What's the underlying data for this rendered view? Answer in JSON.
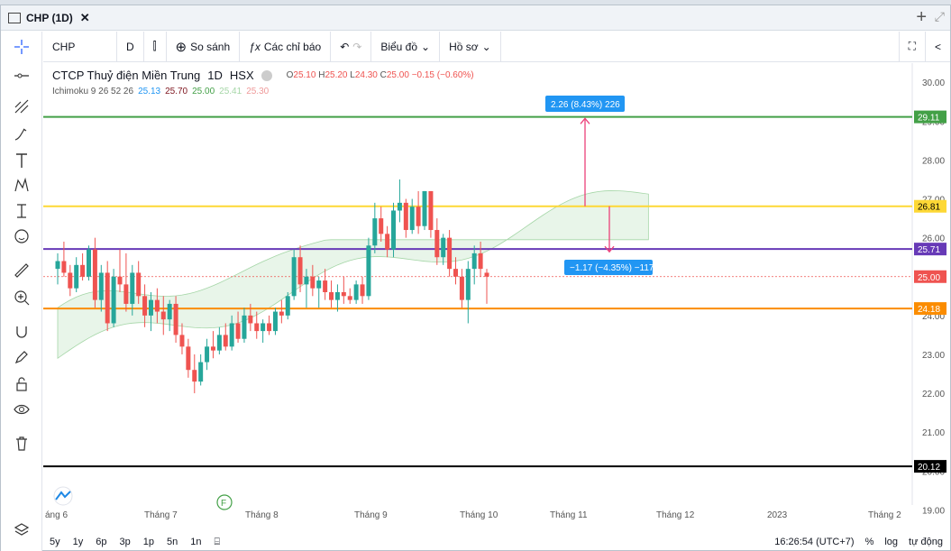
{
  "window": {
    "tab_title": "CHP (1D)",
    "close": "✕"
  },
  "toolbar": {
    "symbol": "CHP",
    "interval": "D",
    "compare": "So sánh",
    "indicators": "Các chỉ báo",
    "chart_type": "Biểu đồ",
    "profile": "Hồ sơ"
  },
  "legend": {
    "name": "CTCP Thuỷ điện Miền Trung",
    "interval": "1D",
    "exchange": "HSX",
    "o_label": "O",
    "o": "25.10",
    "h_label": "H",
    "h": "25.20",
    "l_label": "L",
    "l": "24.30",
    "c_label": "C",
    "c": "25.00",
    "change": "−0.15 (−0.60%)",
    "ichimoku_label": "Ichimoku 9 26 52 26",
    "ichimoku_values": [
      "25.13",
      "25.70",
      "25.00",
      "25.41",
      "25.30"
    ]
  },
  "measure": {
    "up_label": "2.26 (8.43%) 226",
    "down_label": "−1.17 (−4.35%) −117"
  },
  "hlines": [
    {
      "value": 29.11,
      "label": "29.11",
      "color": "#43a047"
    },
    {
      "value": 26.81,
      "label": "26.81",
      "color": "#fdd835"
    },
    {
      "value": 25.71,
      "label": "25.71",
      "color": "#673ab7"
    },
    {
      "value": 24.18,
      "label": "24.18",
      "color": "#fb8c00"
    },
    {
      "value": 20.12,
      "label": "20.12",
      "color": "#000000"
    }
  ],
  "last_price": {
    "value": 25.0,
    "label": "25.00",
    "color": "#ef5350"
  },
  "y_ticks": [
    "30.00",
    "29.00",
    "28.00",
    "27.00",
    "26.00",
    "25.00",
    "24.00",
    "23.00",
    "22.00",
    "21.00",
    "20.00",
    "19.00"
  ],
  "x_ticks": [
    "áng 6",
    "Tháng 7",
    "Tháng 8",
    "Tháng 9",
    "Tháng 10",
    "Tháng 11",
    "Tháng 12",
    "2023",
    "Tháng 2"
  ],
  "bottom": {
    "ranges": [
      "5y",
      "1y",
      "6p",
      "3p",
      "1p",
      "5n",
      "1n"
    ],
    "time": "16:26:54 (UTC+7)",
    "percent": "%",
    "log": "log",
    "auto": "tự động"
  },
  "chart_data": {
    "type": "candlestick",
    "colors": {
      "up": "#26a69a",
      "down": "#ef5350"
    },
    "ylim": [
      18.8,
      30.4
    ],
    "candles": [
      [
        25.2,
        25.6,
        24.8,
        25.4
      ],
      [
        25.4,
        25.9,
        25.0,
        25.1
      ],
      [
        25.1,
        25.3,
        24.5,
        24.7
      ],
      [
        24.7,
        25.5,
        24.6,
        25.3
      ],
      [
        25.3,
        25.6,
        24.9,
        25.0
      ],
      [
        25.0,
        25.8,
        24.9,
        25.7
      ],
      [
        25.7,
        26.0,
        24.2,
        24.4
      ],
      [
        24.4,
        25.3,
        24.1,
        25.1
      ],
      [
        25.1,
        25.4,
        23.6,
        23.8
      ],
      [
        23.8,
        25.2,
        23.7,
        25.0
      ],
      [
        25.0,
        25.7,
        24.6,
        24.8
      ],
      [
        24.8,
        25.6,
        24.1,
        24.3
      ],
      [
        24.3,
        25.3,
        24.0,
        25.1
      ],
      [
        25.1,
        25.4,
        24.3,
        24.5
      ],
      [
        24.5,
        24.8,
        23.7,
        24.0
      ],
      [
        24.0,
        24.6,
        23.6,
        24.4
      ],
      [
        24.4,
        24.7,
        23.8,
        24.1
      ],
      [
        24.1,
        24.5,
        23.5,
        23.9
      ],
      [
        23.9,
        24.4,
        23.6,
        24.3
      ],
      [
        24.3,
        24.5,
        23.3,
        23.5
      ],
      [
        23.5,
        23.8,
        23.0,
        23.2
      ],
      [
        23.2,
        23.4,
        22.4,
        22.6
      ],
      [
        22.6,
        23.0,
        22.0,
        22.3
      ],
      [
        22.3,
        23.0,
        22.2,
        22.8
      ],
      [
        22.8,
        23.4,
        22.6,
        23.2
      ],
      [
        23.2,
        23.6,
        22.9,
        23.1
      ],
      [
        23.1,
        23.7,
        23.0,
        23.5
      ],
      [
        23.5,
        23.8,
        23.1,
        23.2
      ],
      [
        23.2,
        24.0,
        23.1,
        23.8
      ],
      [
        23.8,
        24.1,
        23.3,
        23.4
      ],
      [
        23.4,
        24.2,
        23.3,
        24.0
      ],
      [
        24.0,
        24.3,
        23.6,
        23.8
      ],
      [
        23.8,
        24.1,
        23.4,
        23.6
      ],
      [
        23.6,
        23.9,
        23.3,
        23.8
      ],
      [
        23.8,
        24.0,
        23.5,
        23.6
      ],
      [
        23.6,
        24.2,
        23.5,
        24.1
      ],
      [
        24.1,
        24.4,
        23.8,
        24.0
      ],
      [
        24.0,
        24.6,
        23.9,
        24.5
      ],
      [
        24.5,
        25.7,
        24.4,
        25.5
      ],
      [
        25.5,
        25.8,
        24.6,
        24.8
      ],
      [
        24.8,
        25.2,
        24.2,
        25.0
      ],
      [
        25.0,
        25.3,
        24.5,
        24.7
      ],
      [
        24.7,
        25.0,
        24.2,
        24.9
      ],
      [
        24.9,
        25.2,
        24.4,
        24.6
      ],
      [
        24.6,
        24.9,
        24.2,
        24.4
      ],
      [
        24.4,
        24.8,
        24.1,
        24.6
      ],
      [
        24.6,
        25.0,
        24.3,
        24.5
      ],
      [
        24.5,
        24.7,
        24.3,
        24.4
      ],
      [
        24.4,
        24.9,
        24.3,
        24.8
      ],
      [
        24.8,
        25.0,
        24.3,
        24.5
      ],
      [
        24.5,
        26.0,
        24.4,
        25.8
      ],
      [
        25.8,
        26.9,
        25.6,
        26.5
      ],
      [
        26.5,
        26.8,
        25.9,
        26.1
      ],
      [
        26.1,
        26.3,
        25.5,
        25.7
      ],
      [
        25.7,
        26.9,
        25.5,
        26.7
      ],
      [
        26.7,
        27.5,
        26.4,
        26.9
      ],
      [
        26.9,
        27.0,
        26.0,
        26.2
      ],
      [
        26.2,
        27.0,
        26.1,
        26.8
      ],
      [
        26.8,
        27.2,
        26.1,
        26.3
      ],
      [
        26.3,
        27.2,
        26.2,
        27.2
      ],
      [
        27.2,
        27.2,
        26.0,
        26.2
      ],
      [
        26.2,
        26.5,
        25.3,
        25.5
      ],
      [
        25.5,
        26.1,
        25.3,
        26.0
      ],
      [
        26.0,
        26.2,
        25.0,
        25.2
      ],
      [
        25.2,
        25.5,
        24.8,
        25.0
      ],
      [
        25.0,
        25.2,
        24.2,
        24.4
      ],
      [
        24.4,
        25.4,
        23.8,
        25.2
      ],
      [
        25.2,
        25.8,
        24.8,
        25.6
      ],
      [
        25.6,
        25.9,
        25.0,
        25.2
      ],
      [
        25.1,
        25.2,
        24.3,
        25.0
      ]
    ]
  }
}
